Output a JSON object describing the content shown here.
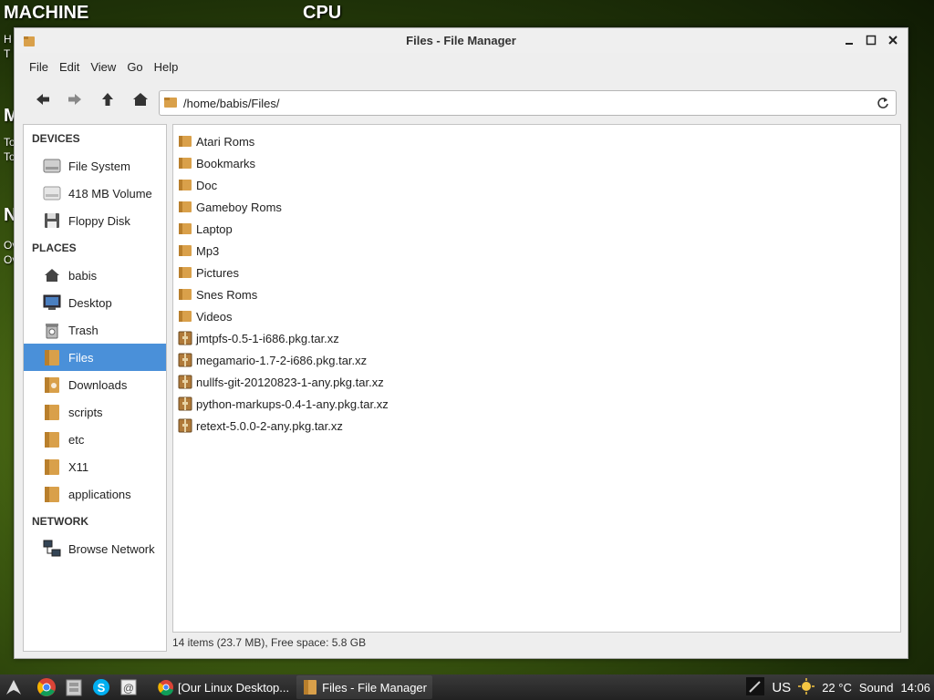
{
  "desktop": {
    "machine": "MACHINE",
    "cpu": "CPU",
    "frag_h": "H",
    "frag_t": "T",
    "frag_m": "M",
    "frag_to1": "To",
    "frag_to2": "To",
    "frag_n": "N",
    "frag_ov1": "Ov",
    "frag_ov2": "Ov"
  },
  "window": {
    "title": "Files - File Manager"
  },
  "menu": [
    "File",
    "Edit",
    "View",
    "Go",
    "Help"
  ],
  "toolbar": {
    "path": "/home/babis/Files/"
  },
  "sidebar": {
    "devices_header": "DEVICES",
    "devices": [
      {
        "label": "File System",
        "icon": "hard-drive-icon"
      },
      {
        "label": "418 MB Volume",
        "icon": "removable-drive-icon"
      },
      {
        "label": "Floppy Disk",
        "icon": "floppy-disk-icon"
      }
    ],
    "places_header": "PLACES",
    "places": [
      {
        "label": "babis",
        "icon": "home-icon"
      },
      {
        "label": "Desktop",
        "icon": "desktop-icon"
      },
      {
        "label": "Trash",
        "icon": "trash-icon"
      },
      {
        "label": "Files",
        "icon": "folder-icon",
        "selected": true
      },
      {
        "label": "Downloads",
        "icon": "downloads-folder-icon"
      },
      {
        "label": "scripts",
        "icon": "folder-icon"
      },
      {
        "label": "etc",
        "icon": "folder-icon"
      },
      {
        "label": "X11",
        "icon": "folder-icon"
      },
      {
        "label": "applications",
        "icon": "folder-icon"
      }
    ],
    "network_header": "NETWORK",
    "network": [
      {
        "label": "Browse Network",
        "icon": "network-icon"
      }
    ]
  },
  "files": [
    {
      "name": "Atari Roms",
      "type": "folder"
    },
    {
      "name": "Bookmarks",
      "type": "folder"
    },
    {
      "name": "Doc",
      "type": "folder"
    },
    {
      "name": "Gameboy Roms",
      "type": "folder"
    },
    {
      "name": "Laptop",
      "type": "folder"
    },
    {
      "name": "Mp3",
      "type": "folder"
    },
    {
      "name": "Pictures",
      "type": "folder"
    },
    {
      "name": "Snes Roms",
      "type": "folder"
    },
    {
      "name": "Videos",
      "type": "folder"
    },
    {
      "name": "jmtpfs-0.5-1-i686.pkg.tar.xz",
      "type": "archive"
    },
    {
      "name": "megamario-1.7-2-i686.pkg.tar.xz",
      "type": "archive"
    },
    {
      "name": "nullfs-git-20120823-1-any.pkg.tar.xz",
      "type": "archive"
    },
    {
      "name": "python-markups-0.4-1-any.pkg.tar.xz",
      "type": "archive"
    },
    {
      "name": "retext-5.0.0-2-any.pkg.tar.xz",
      "type": "archive"
    }
  ],
  "status": "14 items (23.7 MB), Free space: 5.8 GB",
  "taskbar": {
    "tasks": [
      {
        "label": "[Our Linux Desktop...",
        "icon": "chrome-icon"
      },
      {
        "label": "Files - File Manager",
        "icon": "folder-icon"
      }
    ],
    "keyboard": "US",
    "weather": "22 °C",
    "sound": "Sound",
    "clock": "14:06"
  },
  "colors": {
    "selection": "#4a90d9",
    "folder": "#d9a04a",
    "taskbar": "#2a2a2a"
  }
}
